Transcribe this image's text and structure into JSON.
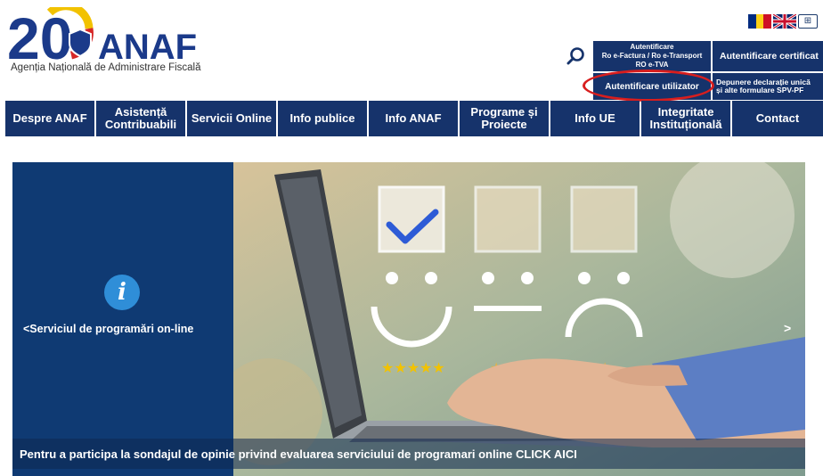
{
  "logo": {
    "anniversary": "20",
    "brand": "ANAF",
    "subtitle": "Agenția Națională de Administrare Fiscală"
  },
  "languages": [
    {
      "name": "romanian-flag-icon"
    },
    {
      "name": "uk-flag-icon"
    }
  ],
  "sitemap_icon": "sitemap-icon",
  "auth": {
    "efactura_lines": [
      "Autentificare",
      "Ro e-Factura / Ro e-Transport",
      "RO e-TVA"
    ],
    "certificate_label": "Autentificare certificat",
    "user_label": "Autentificare utilizator",
    "declaration_lines": [
      "Depunere declarație unică",
      "și alte formulare SPV-PF"
    ]
  },
  "nav": {
    "items": [
      {
        "label": "Despre ANAF"
      },
      {
        "label": "Asistență Contribuabili"
      },
      {
        "label": "Servicii Online"
      },
      {
        "label": "Info publice"
      },
      {
        "label": "Info ANAF"
      },
      {
        "label": "Programe și Proiecte"
      },
      {
        "label": "Info UE"
      },
      {
        "label": "Integritate Instituțională"
      },
      {
        "label": "Contact"
      }
    ]
  },
  "banner": {
    "prev_label": "<Serviciul de programări on-line",
    "next_label": ">",
    "caption": "Pentru a participa la sondajul de opinie privind evaluarea serviciului de programari online CLICK AICI",
    "ratings": [
      "★★★★★",
      "★★★",
      "★"
    ]
  },
  "colors": {
    "nav_bg": "#16336b",
    "banner_left_bg": "#0f3a73",
    "highlight": "#d81e1e",
    "info_icon": "#2f8ed8"
  }
}
